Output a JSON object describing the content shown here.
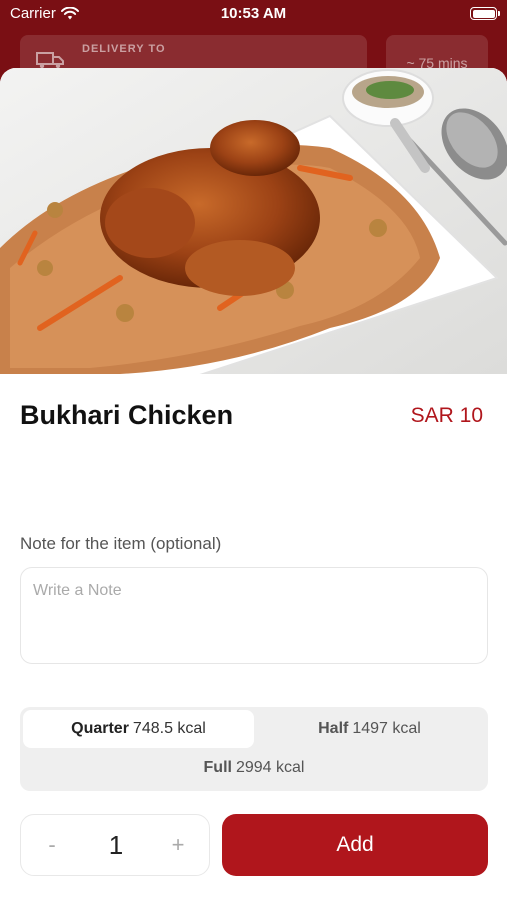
{
  "status_bar": {
    "carrier": "Carrier",
    "time": "10:53 AM"
  },
  "header": {
    "delivery_label": "DELIVERY TO",
    "eta": "~ 75 mins"
  },
  "item": {
    "name": "Bukhari Chicken",
    "price": "SAR 10"
  },
  "note": {
    "label": "Note for the item (optional)",
    "placeholder": "Write a Note",
    "value": ""
  },
  "portions": [
    {
      "name": "Quarter",
      "kcal": "748.5 kcal",
      "selected": true
    },
    {
      "name": "Half",
      "kcal": "1497 kcal",
      "selected": false
    },
    {
      "name": "Full",
      "kcal": "2994 kcal",
      "selected": false
    }
  ],
  "quantity": {
    "minus": "-",
    "value": "1",
    "plus": "+"
  },
  "add_label": "Add",
  "colors": {
    "brand": "#b0161c",
    "header_bg": "#7a0f14"
  },
  "icons": [
    "wifi-icon",
    "battery-icon",
    "truck-icon",
    "chevron-down-icon"
  ]
}
